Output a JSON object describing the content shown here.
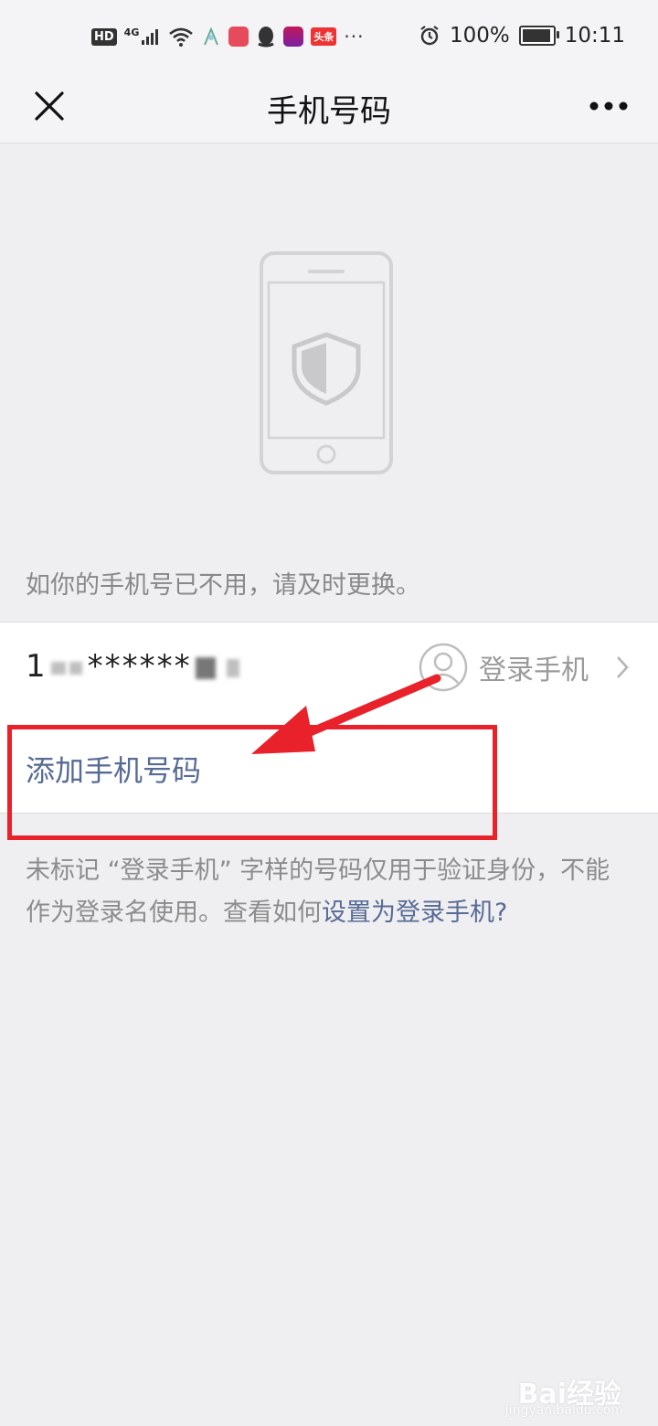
{
  "status_bar": {
    "hd": "HD",
    "network": "4G",
    "more_indicator": "···",
    "battery_percent": "100%",
    "time": "10:11",
    "toutiao": "头条",
    "icons": [
      "signal-icon",
      "wifi-icon",
      "app-icon",
      "book-app-icon",
      "qq-icon",
      "media-app-icon",
      "alarm-icon",
      "battery-charging-icon"
    ]
  },
  "nav": {
    "title": "手机号码",
    "close_icon": "close-icon",
    "more_icon": "more-icon"
  },
  "illustration": {
    "icon": "phone-shield-icon"
  },
  "tip": "如你的手机号已不用，请及时更换。",
  "phone_row": {
    "number_visible_prefix": "1",
    "masked": "******",
    "login_label": "登录手机",
    "user_icon": "user-icon",
    "chevron_icon": "chevron-right-icon"
  },
  "add_row": {
    "label": "添加手机号码"
  },
  "note": {
    "text": "未标记 “登录手机” 字样的号码仅用于验证身份，不能作为登录名使用。查看如何",
    "link": "设置为登录手机",
    "suffix": "?"
  },
  "watermark": {
    "main": "Bai经验",
    "sub": "jingyan.baidu.com"
  },
  "colors": {
    "accent_link": "#576b95",
    "highlight": "#e8212b",
    "background": "#efeff2"
  }
}
